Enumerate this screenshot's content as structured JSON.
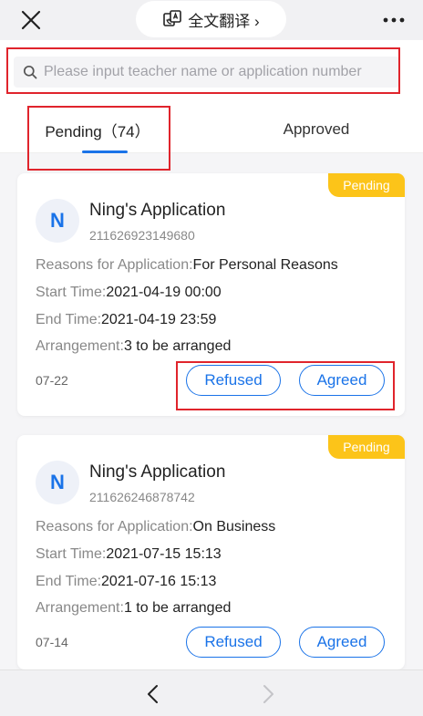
{
  "header": {
    "close_icon": "close-icon",
    "translate_label": "全文翻译 ›",
    "translate_icon": "translate-icon",
    "more_icon": "more-icon"
  },
  "search": {
    "placeholder": "Please input teacher name or application number",
    "icon": "search-icon"
  },
  "tabs": [
    {
      "label": "Pending（74）",
      "active": true
    },
    {
      "label": "Approved",
      "active": false
    }
  ],
  "labels": {
    "reasons": "Reasons for Application:",
    "start": "Start Time:",
    "end": "End Time:",
    "arrangement": "Arrangement:",
    "refused": "Refused",
    "agreed": "Agreed"
  },
  "cards": [
    {
      "badge": "Pending",
      "avatar": "N",
      "title": "Ning's Application",
      "number": "211626923149680",
      "reasons": "For Personal Reasons",
      "start": "2021-04-19 00:00",
      "end": "2021-04-19 23:59",
      "arrangement": "3 to be arranged",
      "date": "07-22"
    },
    {
      "badge": "Pending",
      "avatar": "N",
      "title": "Ning's Application",
      "number": "211626246878742",
      "reasons": "On Business",
      "start": "2021-07-15 15:13",
      "end": "2021-07-16 15:13",
      "arrangement": "1 to be arranged",
      "date": "07-14"
    }
  ],
  "footer": {
    "back_icon": "chevron-left-icon",
    "forward_icon": "chevron-right-icon"
  },
  "colors": {
    "accent": "#1a73e8",
    "badge": "#fcc419",
    "highlight": "#e0242c"
  }
}
